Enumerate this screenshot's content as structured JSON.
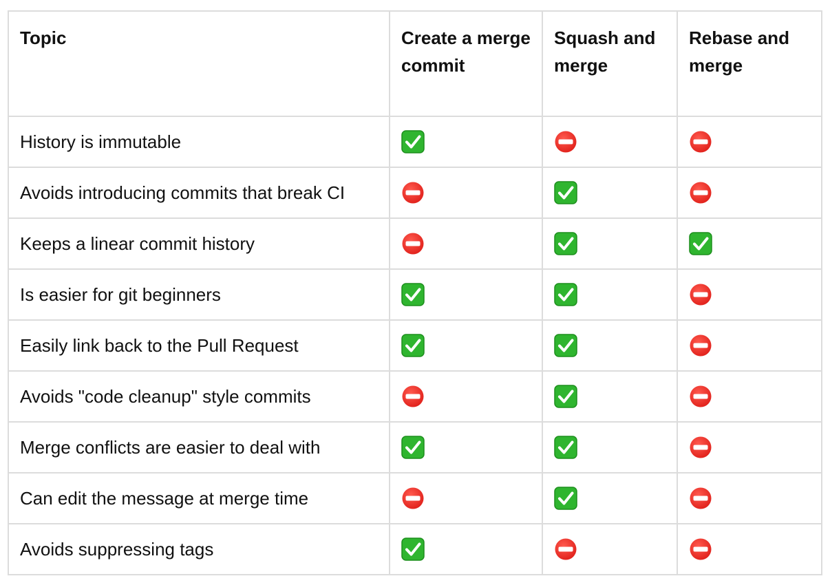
{
  "colors": {
    "check_fill": "#2fb52f",
    "check_stroke": "#1d8f1d",
    "no_entry_fill": "#e0201a",
    "grid_border": "#dcdcdc"
  },
  "headers": [
    "Topic",
    "Create a merge commit",
    "Squash and merge",
    "Rebase and merge"
  ],
  "rows": [
    {
      "topic": "History is immutable",
      "values": [
        "check",
        "no",
        "no"
      ]
    },
    {
      "topic": "Avoids introducing commits that break CI",
      "values": [
        "no",
        "check",
        "no"
      ]
    },
    {
      "topic": "Keeps a linear commit history",
      "values": [
        "no",
        "check",
        "check"
      ]
    },
    {
      "topic": "Is easier for git beginners",
      "values": [
        "check",
        "check",
        "no"
      ]
    },
    {
      "topic": "Easily link back to the Pull Request",
      "values": [
        "check",
        "check",
        "no"
      ]
    },
    {
      "topic": "Avoids \"code cleanup\" style commits",
      "values": [
        "no",
        "check",
        "no"
      ]
    },
    {
      "topic": "Merge conflicts are easier to deal with",
      "values": [
        "check",
        "check",
        "no"
      ]
    },
    {
      "topic": "Can edit the message at merge time",
      "values": [
        "no",
        "check",
        "no"
      ]
    },
    {
      "topic": "Avoids suppressing tags",
      "values": [
        "check",
        "no",
        "no"
      ]
    }
  ]
}
